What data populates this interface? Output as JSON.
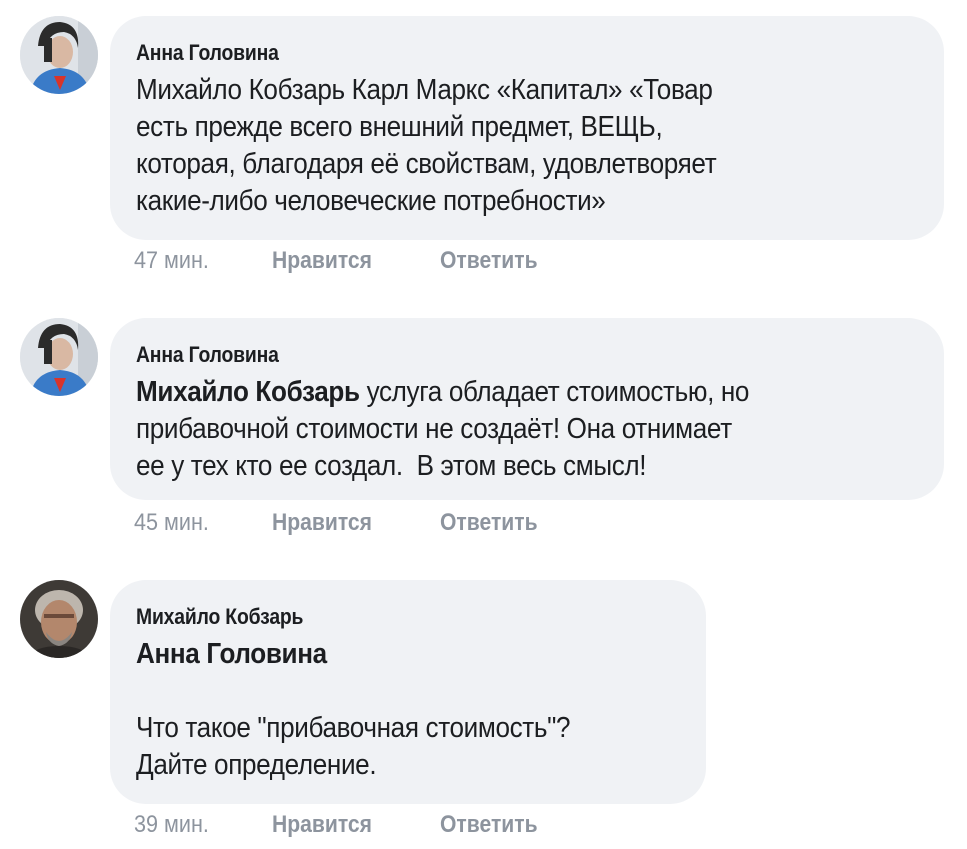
{
  "comments": [
    {
      "author": "Анна Головина",
      "lines": [
        "Михайло Кобзарь Карл Маркс «Капитал» «Товар",
        "есть прежде всего внешний предмет, ВЕЩЬ,",
        "которая, благодаря её свойствам, удовлетворяет",
        "какие-либо человеческие потребности»"
      ],
      "time": "47 мин.",
      "like": "Нравится",
      "reply": "Ответить"
    },
    {
      "author": "Анна Головина",
      "mention": "Михайло Кобзарь",
      "lines": [
        " услуга обладает стоимостью, но",
        "прибавочной стоимости не создаёт! Она отнимает",
        "ее у тех кто ее создал.  В этом весь смысл!"
      ],
      "time": "45 мин.",
      "like": "Нравится",
      "reply": "Ответить"
    },
    {
      "author": "Михайло Кобзарь",
      "mention": "Анна Головина",
      "lines": [
        "Что такое \"прибавочная стоимость\"?",
        "Дайте определение."
      ],
      "time": "39 мин.",
      "like": "Нравится",
      "reply": "Ответить"
    }
  ],
  "colors": {
    "bubble": "#f0f2f5",
    "text": "#1c1e21",
    "meta": "#8d949e"
  }
}
